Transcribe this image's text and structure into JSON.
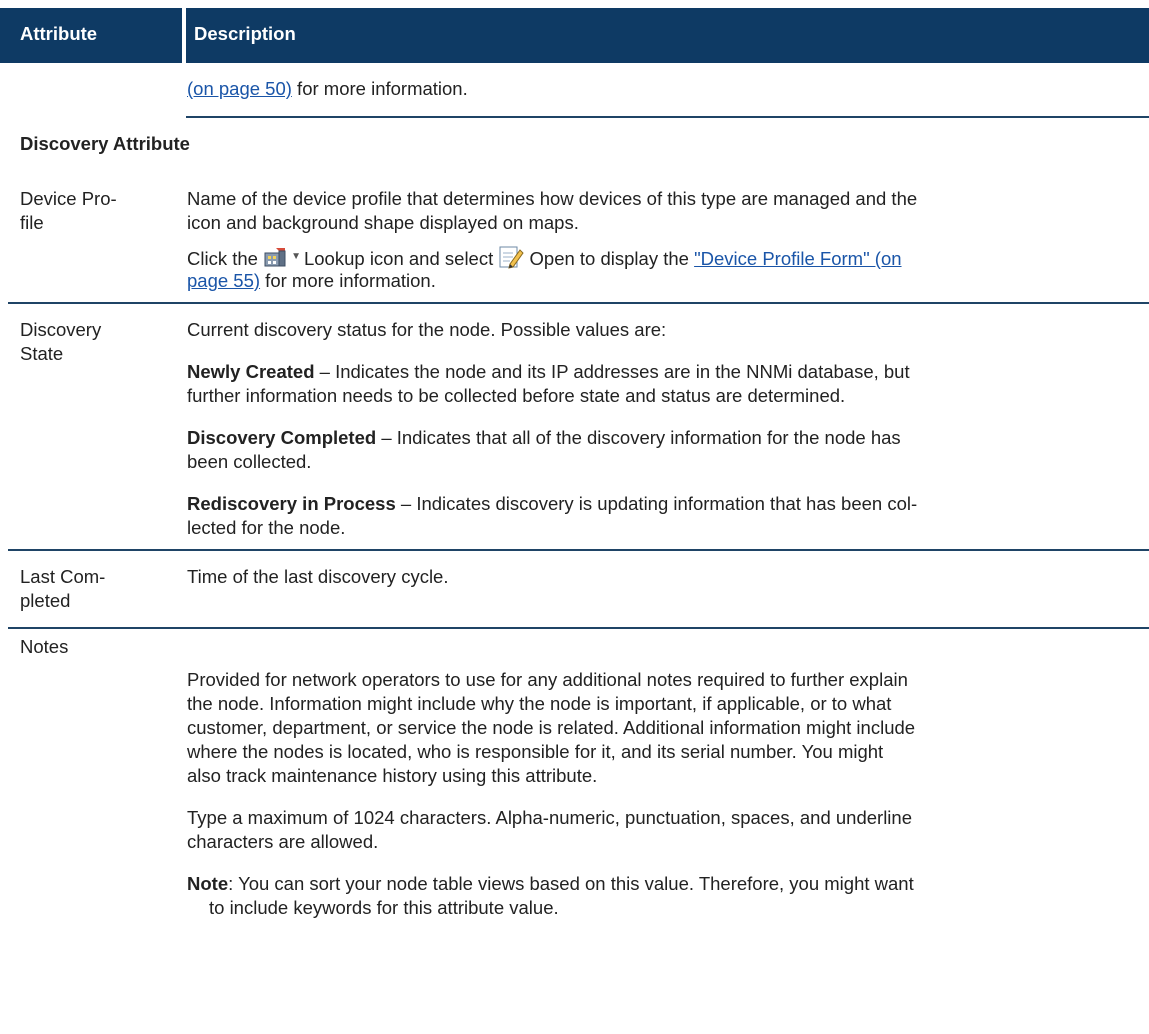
{
  "header": {
    "attribute": "Attribute",
    "description": "Description"
  },
  "top_row": {
    "link": "(on page 50)",
    "text": " for more information."
  },
  "section_title": "Discovery Attribute",
  "device_profile": {
    "attr_line1": "Device Pro-",
    "attr_line2": "file",
    "desc_line1": "Name of the device profile that determines how devices of this type are managed and the",
    "desc_line2": "icon and background shape displayed on maps.",
    "click_the": "Click the ",
    "lookup_text": "Lookup icon and select ",
    "open_text": " Open to display the ",
    "link_line1": "\"Device Profile Form\" (on",
    "link_line2": "page 55)",
    "after_link": " for more information."
  },
  "discovery_state": {
    "attr_line1": "Discovery",
    "attr_line2": "State",
    "intro": "Current discovery status for the node. Possible values are:",
    "newly_created_label": "Newly Created",
    "newly_created_line1": " – Indicates the node and its IP addresses are in the NNMi database, but",
    "newly_created_line2": "further information needs to be collected before state and status are determined.",
    "completed_label": "Discovery Completed",
    "completed_line1": " – Indicates that all of the discovery information for the node has",
    "completed_line2": "been collected.",
    "rediscovery_label": "Rediscovery in Process",
    "rediscovery_line1": " – Indicates discovery is updating information that has been col-",
    "rediscovery_line2": "lected for the node."
  },
  "last_completed": {
    "attr_line1": "Last Com-",
    "attr_line2": "pleted",
    "desc": "Time of the last discovery cycle."
  },
  "notes": {
    "attr": "Notes",
    "p1_lines": [
      "Provided for network operators to use for any additional notes required to further explain",
      "the node. Information might include why the node is important, if applicable, or to what",
      "customer, department, or service the node is related. Additional information might include",
      "where the nodes is located, who is responsible for it, and its serial number. You might",
      "also track maintenance history using this attribute."
    ],
    "p2_lines": [
      "Type a maximum of 1024 characters. Alpha-numeric, punctuation, spaces, and underline",
      "characters are allowed."
    ],
    "note_label": "Note",
    "note_line1": ": You can sort your node table views based on this value. Therefore, you might want",
    "note_line2": "to include keywords for this attribute value."
  }
}
